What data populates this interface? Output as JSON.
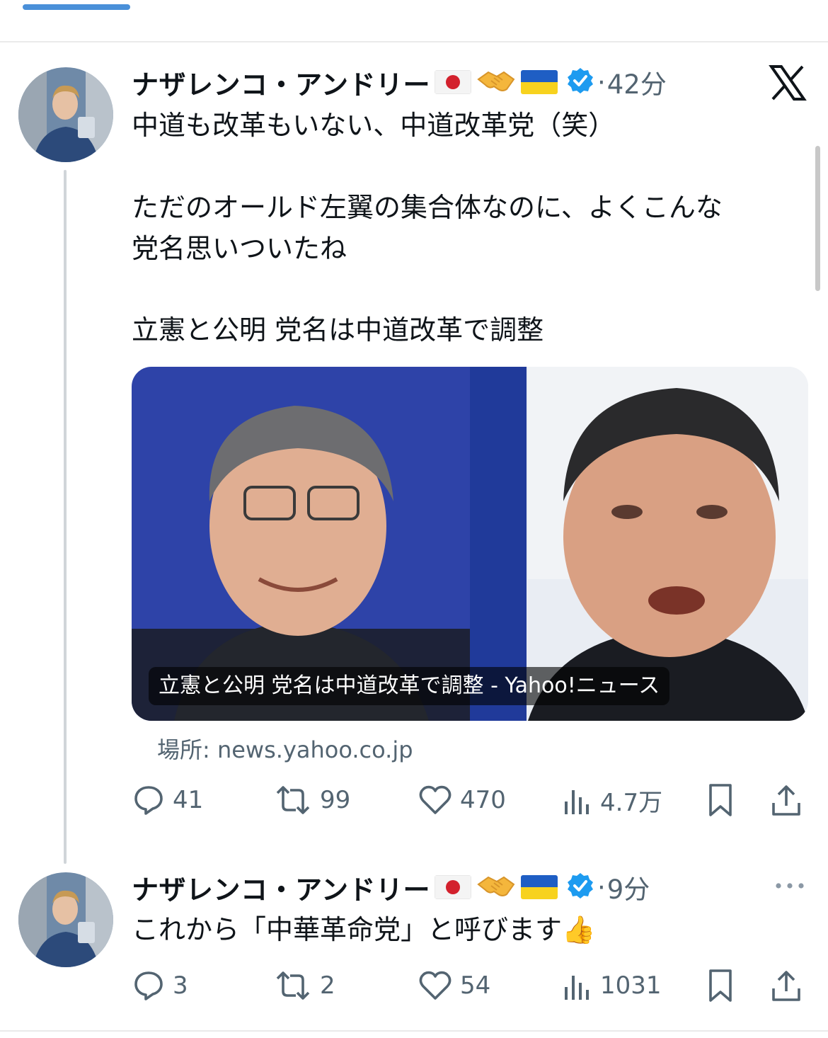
{
  "posts": [
    {
      "author": "ナザレンコ・アンドリー",
      "time": "42分",
      "lines": [
        "中道も改革もいない、中道改革党（笑）",
        "",
        "ただのオールド左翼の集合体なのに、よくこんな",
        "党名思いついたね",
        "",
        "立憲と公明 党名は中道改革で調整"
      ],
      "card": {
        "caption": "立憲と公明 党名は中道改革で調整 - Yahoo!ニュース",
        "source": "場所: news.yahoo.co.jp"
      },
      "stats": {
        "replies": "41",
        "reposts": "99",
        "likes": "470",
        "views": "4.7万"
      }
    },
    {
      "author": "ナザレンコ・アンドリー",
      "time": "9分",
      "lines": [
        "これから「中華革命党」と呼びます👍"
      ],
      "stats": {
        "replies": "3",
        "reposts": "2",
        "likes": "54",
        "views": "1031"
      }
    }
  ],
  "icons": {
    "brand": "x-logo-icon",
    "flags": [
      "japan-flag-icon",
      "handshake-icon",
      "ukraine-flag-icon"
    ]
  },
  "colors": {
    "verified": "#1d9bf0",
    "secondary": "#536471",
    "separator": "#eaeaea"
  }
}
